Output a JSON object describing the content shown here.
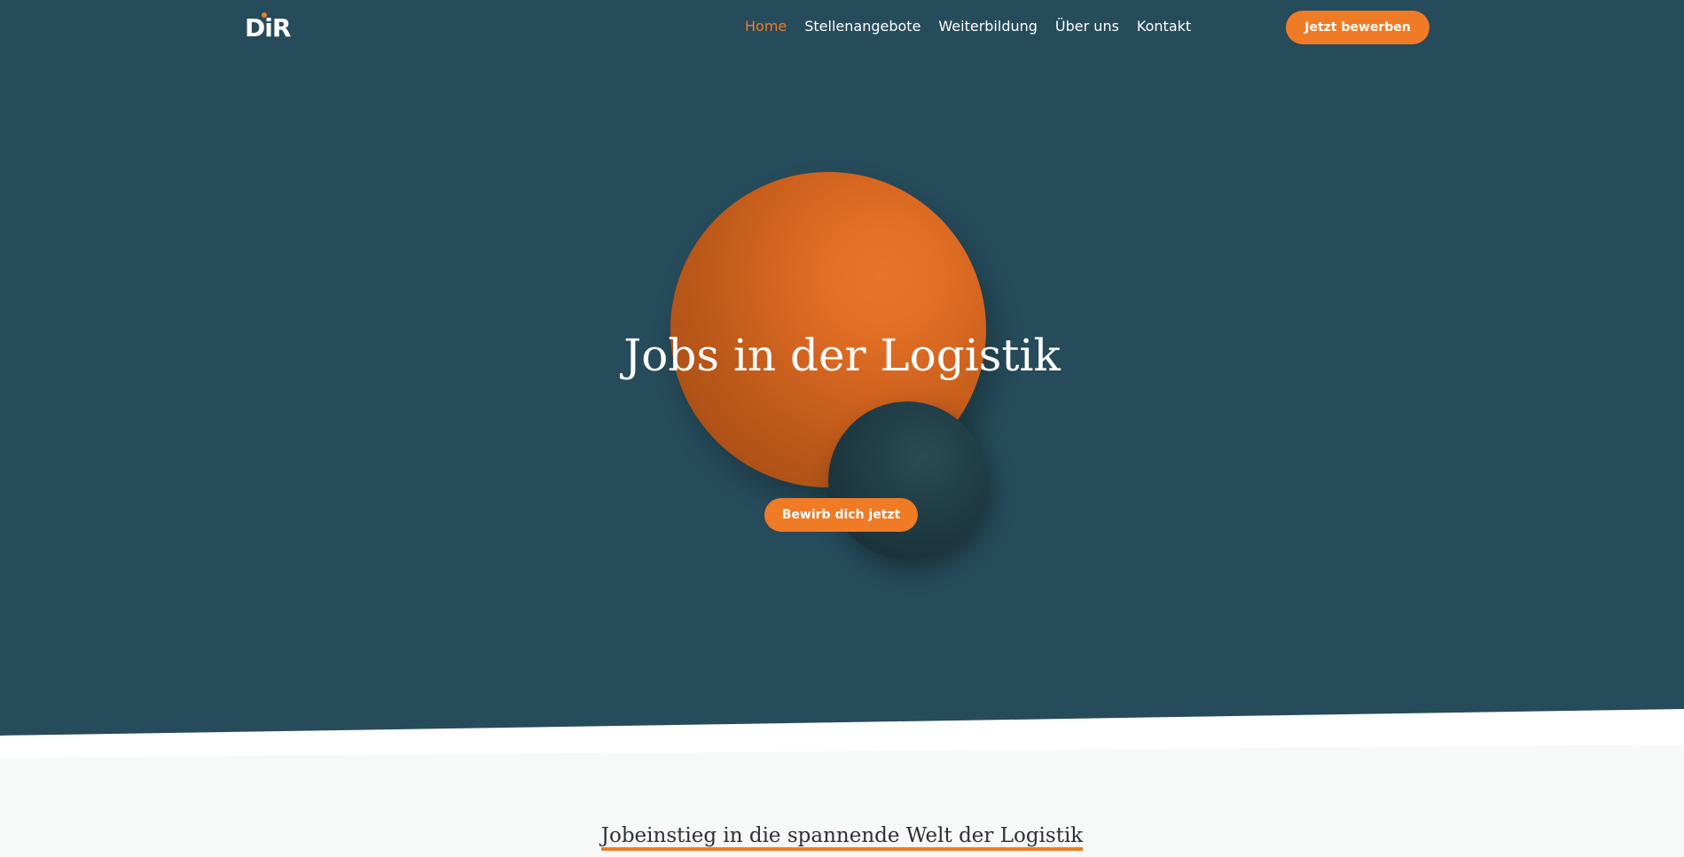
{
  "header": {
    "logo_text": "DiR",
    "nav": [
      {
        "label": "Home",
        "active": true
      },
      {
        "label": "Stellenangebote",
        "active": false
      },
      {
        "label": "Weiterbildung",
        "active": false
      },
      {
        "label": "Über uns",
        "active": false
      },
      {
        "label": "Kontakt",
        "active": false
      }
    ],
    "apply_label": "Jetzt bewerben"
  },
  "hero": {
    "title": "Jobs in der Logistik",
    "cta_label": "Bewirb dich jetzt"
  },
  "section": {
    "title": "Jobeinstieg in die spannende Welt der Logistik"
  },
  "colors": {
    "hero_bg": "#264b5a",
    "accent": "#ef7b26",
    "text_light": "#ffffff",
    "section_bg": "#f7f9f9"
  }
}
